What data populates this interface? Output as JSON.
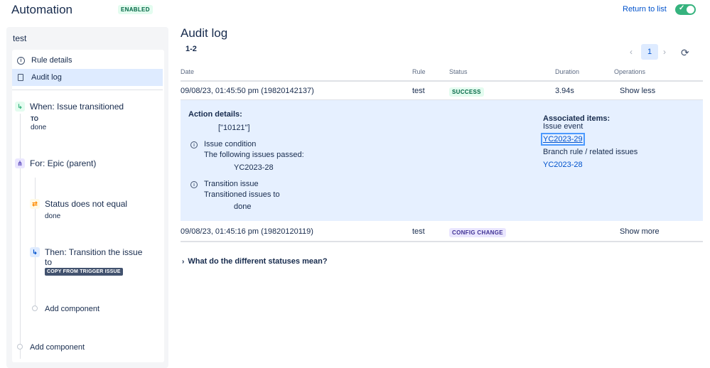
{
  "header": {
    "title": "Automation",
    "status_badge": "ENABLED",
    "return_link": "Return to list",
    "toggle_state": "on"
  },
  "sidebar": {
    "rule_name": "test",
    "nav": [
      {
        "label": "Rule details",
        "icon": "info-icon"
      },
      {
        "label": "Audit log",
        "icon": "document-icon"
      }
    ],
    "components": {
      "trigger": {
        "title": "When: Issue transitioned",
        "sub_label": "TO",
        "sub_value": "done"
      },
      "branch": {
        "title": "For: Epic (parent)"
      },
      "condition": {
        "title": "Status does not equal",
        "value": "done"
      },
      "action": {
        "title_line1": "Then: Transition the issue",
        "title_line2": "to",
        "badge": "COPY FROM TRIGGER ISSUE"
      },
      "add_inner": "Add component",
      "add_outer": "Add component"
    }
  },
  "main": {
    "title": "Audit log",
    "range": "1-2",
    "pagination": {
      "current_page": "1"
    },
    "table": {
      "headers": {
        "date": "Date",
        "rule": "Rule",
        "status": "Status",
        "duration": "Duration",
        "operations": "Operations"
      },
      "rows": [
        {
          "date": "09/08/23, 01:45:50 pm (19820142137)",
          "rule": "test",
          "status": "SUCCESS",
          "duration": "3.94s",
          "operation": "Show less"
        },
        {
          "date": "09/08/23, 01:45:16 pm (19820120119)",
          "rule": "test",
          "status": "CONFIG CHANGE",
          "duration": "",
          "operation": "Show more"
        }
      ]
    },
    "details": {
      "action_details_label": "Action details:",
      "action_value": "[\"10121\"]",
      "condition": {
        "title": "Issue condition",
        "description": "The following issues passed:",
        "value": "YC2023-28"
      },
      "transition": {
        "title": "Transition issue",
        "description": "Transitioned issues to",
        "value": "done"
      },
      "associated_label": "Associated items:",
      "issue_event_label": "Issue event",
      "issue_event_link": "YC2023-29",
      "branch_label": "Branch rule / related issues",
      "branch_link": "YC2023-28"
    },
    "expander": "What do the different statuses mean?"
  },
  "colors": {
    "brand_blue": "#0052cc",
    "success_green": "#36b37e",
    "selected_bg": "#deebff",
    "text": "#172b4d"
  }
}
